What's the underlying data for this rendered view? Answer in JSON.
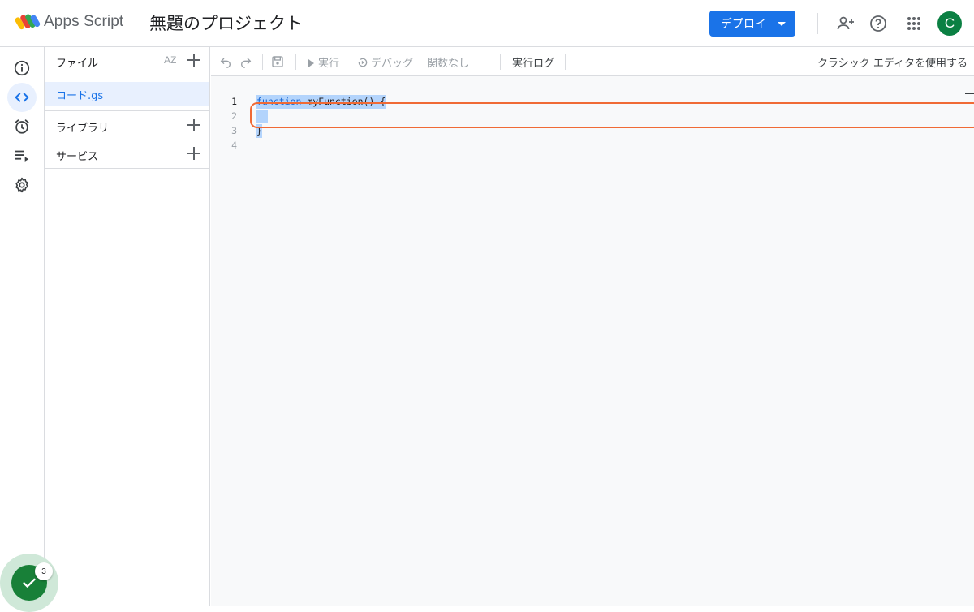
{
  "header": {
    "app_name": "Apps Script",
    "project_title": "無題のプロジェクト",
    "deploy_label": "デプロイ",
    "avatar_initial": "C"
  },
  "rail": {
    "items": [
      {
        "icon": "info-icon",
        "active": false
      },
      {
        "icon": "code-icon",
        "active": true
      },
      {
        "icon": "alarm-clock-icon",
        "active": false
      },
      {
        "icon": "executions-icon",
        "active": false
      },
      {
        "icon": "gear-icon",
        "active": false
      }
    ]
  },
  "files_panel": {
    "files_label": "ファイル",
    "sort_label": "AZ",
    "files": [
      "コード.gs"
    ],
    "libraries_label": "ライブラリ",
    "services_label": "サービス"
  },
  "toolbar": {
    "run_label": "実行",
    "debug_label": "デバッグ",
    "function_select": "関数なし",
    "log_label": "実行ログ",
    "classic_label": "クラシック エディタを使用する"
  },
  "editor": {
    "lines": [
      {
        "num": "1",
        "keyword": "function",
        "rest": " myFunction() {"
      },
      {
        "num": "2",
        "keyword": "",
        "rest": "  "
      },
      {
        "num": "3",
        "keyword": "",
        "rest": "}"
      },
      {
        "num": "4",
        "keyword": "",
        "rest": ""
      }
    ]
  },
  "badge": {
    "count": "3"
  },
  "colors": {
    "accent": "#1a73e8",
    "selection": "#b3d4fc",
    "highlight": "#f06a35",
    "avatar": "#0b8043",
    "badge": "#188038"
  }
}
